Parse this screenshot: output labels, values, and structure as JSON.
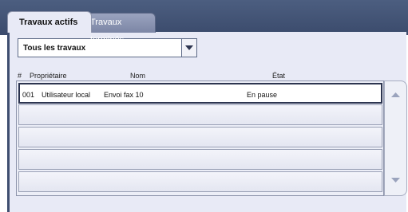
{
  "tabs": [
    {
      "label": "Travaux actifs",
      "active": true
    },
    {
      "label": "Travaux terminés",
      "active": false
    }
  ],
  "filter": {
    "selected": "Tous les travaux"
  },
  "columns": {
    "num": "#",
    "owner": "Propriétaire",
    "name": "Nom",
    "state": "État"
  },
  "rows": [
    {
      "num": "001",
      "owner": "Utilisateur local",
      "name": "Envoi fax 10",
      "state": "En pause"
    }
  ],
  "icons": {
    "dropdown": "chevron-down-icon",
    "scroll_up": "scroll-up-icon",
    "scroll_down": "scroll-down-icon"
  },
  "colors": {
    "header_bar": "#3f4e70",
    "panel": "#e8eaf6",
    "selected_border": "#2d3550"
  }
}
